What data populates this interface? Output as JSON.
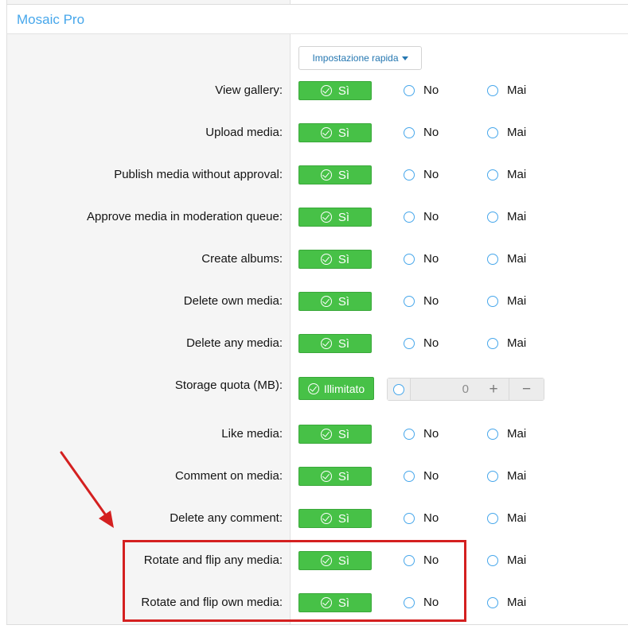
{
  "section": {
    "title": "Mosaic Pro"
  },
  "quick_setting": {
    "label": "Impostazione rapida"
  },
  "options": {
    "yes": "Sì",
    "no": "No",
    "never": "Mai"
  },
  "permissions": [
    {
      "label": "View gallery:"
    },
    {
      "label": "Upload media:"
    },
    {
      "label": "Publish media without approval:"
    },
    {
      "label": "Approve media in moderation queue:"
    },
    {
      "label": "Create albums:"
    },
    {
      "label": "Delete own media:"
    },
    {
      "label": "Delete any media:"
    },
    {
      "label": "Storage quota (MB):"
    },
    {
      "label": "Like media:"
    },
    {
      "label": "Comment on media:"
    },
    {
      "label": "Delete any comment:"
    },
    {
      "label": "Rotate and flip any media:"
    },
    {
      "label": "Rotate and flip own media:"
    }
  ],
  "storage_quota": {
    "unlimited_label": "Illimitato",
    "value": "0",
    "plus": "+",
    "minus": "−"
  },
  "colors": {
    "accent": "#47a7eb",
    "success": "#47c147",
    "annotation": "#d42020"
  }
}
